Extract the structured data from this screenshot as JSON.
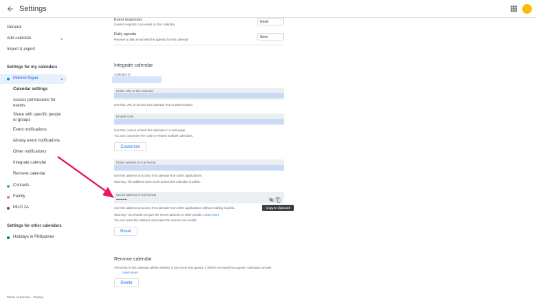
{
  "header": {
    "title": "Settings"
  },
  "sidebar": {
    "general": "General",
    "add_calendar": "Add calendar",
    "import_export": "Import & export",
    "my_cals_head": "Settings for my calendars",
    "user": "Marinel Sigue",
    "sub": [
      "Calendar settings",
      "Access permissions for events",
      "Share with specific people or groups",
      "Event notifications",
      "All-day event notifications",
      "Other notifications",
      "Integrate calendar",
      "Remove calendar"
    ],
    "cals": [
      "Contacts",
      "Family",
      "MUO 2A"
    ],
    "other_head": "Settings for other calendars",
    "holidays": "Holidays in Philippines"
  },
  "main": {
    "event_responses": "Event responses",
    "event_responses_desc": "Guests respond to an event on this calendar",
    "event_responses_val": "Email",
    "daily_agenda": "Daily agenda",
    "daily_agenda_desc": "Receive a daily email with the agenda for this calendar",
    "daily_agenda_val": "None",
    "integrate_title": "Integrate calendar",
    "cal_id": "Calendar ID",
    "public_url": "Public URL to this calendar",
    "public_url_help": "Use this URL to access this calendar from a web browser.",
    "embed": "Embed code",
    "embed_help": "Use this code to embed this calendar in a web page.",
    "embed_help2": "You can customize the code or embed multiple calendars.",
    "customize": "Customize",
    "ical_public": "Public address in iCal format",
    "ical_public_help": "Use this address to access this calendar from other applications.",
    "ical_public_warn": "Warning: The address won't work unless this calendar is public.",
    "ical_secret": "Secret address in iCal format",
    "ical_secret_val": "••••••••••",
    "ical_secret_help": "Use this address to access this calendar from other applications without making it public.",
    "ical_secret_warn": "Warning: You should not give the secret address to other people.",
    "learn_more": "Learn more",
    "reset_help": "You can reset this address and make the current one invalid.",
    "reset": "Reset",
    "remove_title": "Remove calendar",
    "remove_help": "All events in this calendar will be deleted. If any event has guests, it will be removed from guests' calendars as well.",
    "delete": "Delete",
    "tooltip": "Copy to clipboard"
  },
  "footer": {
    "terms": "Terms of Service",
    "sep": " – ",
    "privacy": "Privacy"
  }
}
